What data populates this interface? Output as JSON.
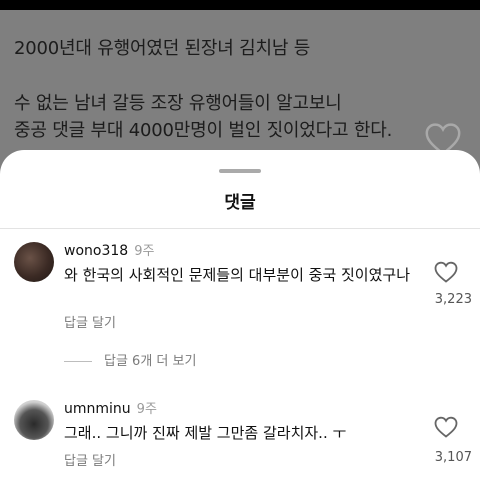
{
  "post": {
    "line1": "2000년대 유행어였던 된장녀 김치남 등",
    "line2": "수 없는 남녀 갈등 조장 유행어들이 알고보니",
    "line3": "중공 댓글 부대 4000만명이 벌인 짓이었다고 한다."
  },
  "sheet": {
    "title": "댓글"
  },
  "comments": [
    {
      "username": "wono318",
      "time": "9주",
      "text": "와 한국의 사회적인 문제들의 대부분이 중국 짓이였구나",
      "reply": "답글 달기",
      "likes": "3,223",
      "more_replies": "답글 6개 더 보기"
    },
    {
      "username": "umnminu",
      "time": "9주",
      "text": "그래.. 그니까 진짜 제발 그만좀 갈라치자.. ㅜ",
      "reply": "답글 달기",
      "likes": "3,107"
    }
  ],
  "icons": {
    "like": "heart-outline-icon"
  },
  "colors": {
    "overlay": "#7f7f7f",
    "sheet": "#ffffff"
  }
}
